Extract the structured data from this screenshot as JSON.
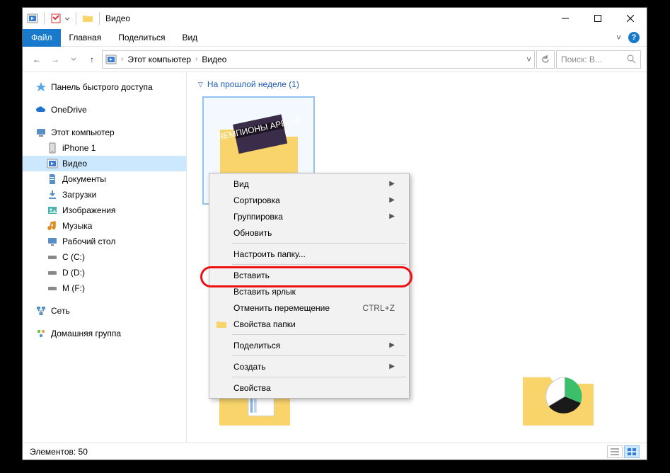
{
  "titlebar": {
    "title": "Видео"
  },
  "ribbon": {
    "file": "Файл",
    "home": "Главная",
    "share": "Поделиться",
    "view": "Вид"
  },
  "nav_buttons": {
    "back": "←",
    "fwd": "→",
    "up": "↑"
  },
  "breadcrumb": {
    "pc": "Этот компьютер",
    "loc": "Видео"
  },
  "search": {
    "placeholder": "Поиск: В..."
  },
  "sidebar": {
    "quick": "Панель быстрого доступа",
    "onedrive": "OneDrive",
    "pc": "Этот компьютер",
    "iphone": "iPhone 1",
    "video": "Видео",
    "docs": "Документы",
    "downloads": "Загрузки",
    "pictures": "Изображения",
    "music": "Музыка",
    "desktop": "Рабочий стол",
    "drive_c": "C (C:)",
    "drive_d": "D (D:)",
    "drive_m": "M (F:)",
    "network": "Сеть",
    "homegroup": "Домашняя группа"
  },
  "group": {
    "header": "На прошлой неделе (1)"
  },
  "thumb_caption": "ЧЕМПИОНЫ АРЕНЫ",
  "context_menu": {
    "view": "Вид",
    "sort": "Сортировка",
    "group": "Группировка",
    "refresh": "Обновить",
    "customize": "Настроить папку...",
    "paste": "Вставить",
    "paste_shortcut": "Вставить ярлык",
    "undo_move": "Отменить перемещение",
    "undo_move_key": "CTRL+Z",
    "folder_props": "Свойства папки",
    "share": "Поделиться",
    "new": "Создать",
    "properties": "Свойства"
  },
  "status": {
    "items": "Элементов: 50"
  }
}
